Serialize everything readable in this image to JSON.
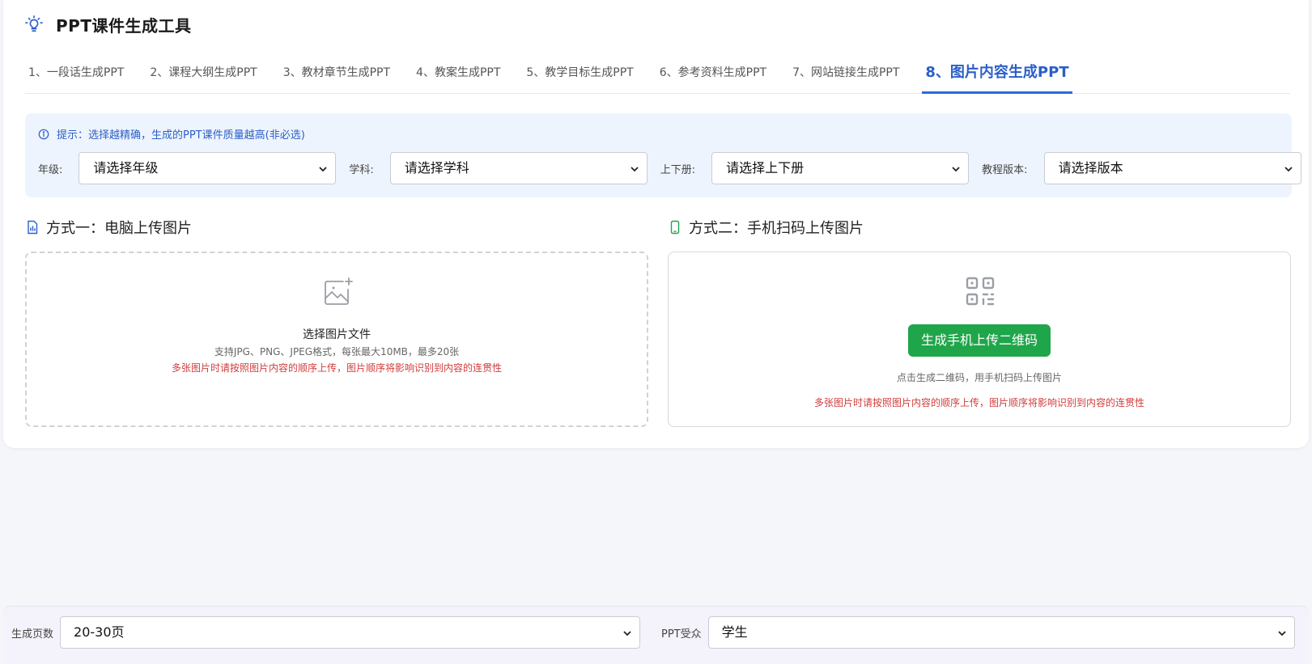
{
  "app": {
    "title": "PPT课件生成工具",
    "icon": "lightbulb-icon"
  },
  "tabs": [
    {
      "label": "1、一段话生成PPT",
      "active": false
    },
    {
      "label": "2、课程大纲生成PPT",
      "active": false
    },
    {
      "label": "3、教材章节生成PPT",
      "active": false
    },
    {
      "label": "4、教案生成PPT",
      "active": false
    },
    {
      "label": "5、教学目标生成PPT",
      "active": false
    },
    {
      "label": "6、参考资料生成PPT",
      "active": false
    },
    {
      "label": "7、网站链接生成PPT",
      "active": false
    },
    {
      "label": "8、图片内容生成PPT",
      "active": true
    }
  ],
  "hint": {
    "text": "提示：选择越精确，生成的PPT课件质量越高(非必选)",
    "icon": "info-icon"
  },
  "filters": {
    "grade": {
      "label": "年级:",
      "value": "请选择年级"
    },
    "subject": {
      "label": "学科:",
      "value": "请选择学科"
    },
    "volume": {
      "label": "上下册:",
      "value": "请选择上下册"
    },
    "edition": {
      "label": "教程版本:",
      "value": "请选择版本"
    }
  },
  "method1": {
    "title": "方式一：电脑上传图片",
    "icon": "document-chart-icon",
    "upload_title": "选择图片文件",
    "upload_sub": "支持JPG、PNG、JPEG格式，每张最大10MB，最多20张",
    "upload_warn": "多张图片时请按照图片内容的顺序上传，图片顺序将影响识别到内容的连贯性",
    "upload_icon": "image-add-icon"
  },
  "method2": {
    "title": "方式二：手机扫码上传图片",
    "icon": "mobile-icon",
    "qr_icon": "qr-code-icon",
    "button_label": "生成手机上传二维码",
    "sub": "点击生成二维码，用手机扫码上传图片",
    "warn": "多张图片时请按照图片内容的顺序上传，图片顺序将影响识别到内容的连贯性"
  },
  "bottom": {
    "pages": {
      "label": "生成页数",
      "value": "20-30页"
    },
    "audience": {
      "label": "PPT受众",
      "value": "学生"
    }
  },
  "colors": {
    "accent": "#2b5fc7",
    "button_green": "#1fa64a",
    "warn_red": "#d23c3c",
    "hint_bg": "#eef4fd"
  }
}
